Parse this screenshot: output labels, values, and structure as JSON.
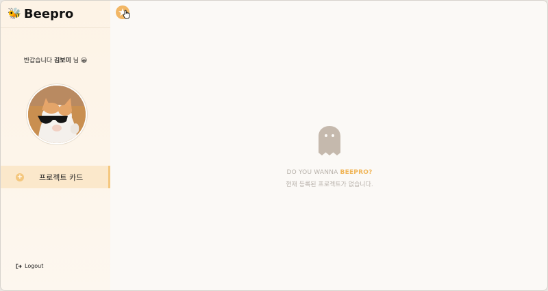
{
  "app": {
    "brand_emoji": "🐝",
    "brand_name": "Beepro"
  },
  "sidebar": {
    "greeting_prefix": "반갑습니다",
    "user_name": "김보미",
    "greeting_suffix": "님",
    "greeting_emoji": "😀",
    "menu": [
      {
        "label": "프로젝트 카드",
        "icon": "plus-circle-icon",
        "active": true
      }
    ],
    "logout_label": "Logout",
    "logout_icon": "sign-out-icon"
  },
  "toolbar": {
    "star_icon": "star-icon"
  },
  "main": {
    "empty_state": {
      "icon": "ghost-icon",
      "line1_prefix": "DO YOU WANNA",
      "line1_accent": "BEEPRO?",
      "line2": "현재 등록된 프로젝트가 없습니다."
    }
  },
  "colors": {
    "accent": "#f4c77e",
    "sidebar_bg": "#fdf3e6",
    "active_item_bg": "#fbe8cb",
    "ghost": "#c5b9ad",
    "text_muted": "#b7b1aa"
  }
}
